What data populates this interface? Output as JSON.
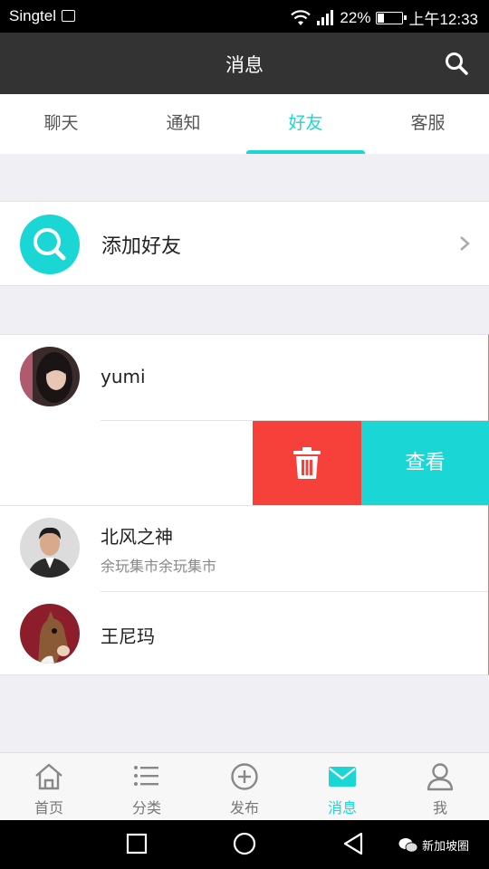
{
  "status_bar": {
    "carrier": "Singtel",
    "battery": "22%",
    "battery_level": 0.22,
    "time": "上午12:33"
  },
  "nav": {
    "title": "消息"
  },
  "tabs": [
    {
      "label": "聊天",
      "active": false
    },
    {
      "label": "通知",
      "active": false
    },
    {
      "label": "好友",
      "active": true
    },
    {
      "label": "客服",
      "active": false
    }
  ],
  "add_friend": {
    "label": "添加好友"
  },
  "friends": [
    {
      "name": "yumi",
      "subtitle": ""
    },
    {
      "name": "北风之神",
      "subtitle": "余玩集市余玩集市"
    },
    {
      "name": "王尼玛",
      "subtitle": ""
    }
  ],
  "swipe_actions": {
    "view_label": "查看"
  },
  "tab_bar": [
    {
      "label": "首页",
      "icon": "home-icon",
      "active": false
    },
    {
      "label": "分类",
      "icon": "list-icon",
      "active": false
    },
    {
      "label": "发布",
      "icon": "plus-circle-icon",
      "active": false
    },
    {
      "label": "消息",
      "icon": "mail-icon",
      "active": true
    },
    {
      "label": "我",
      "icon": "user-icon",
      "active": false
    }
  ],
  "watermark": "新加坡圈",
  "colors": {
    "accent": "#1ad7d6",
    "delete": "#f6413b",
    "nav_bg": "#333333"
  }
}
